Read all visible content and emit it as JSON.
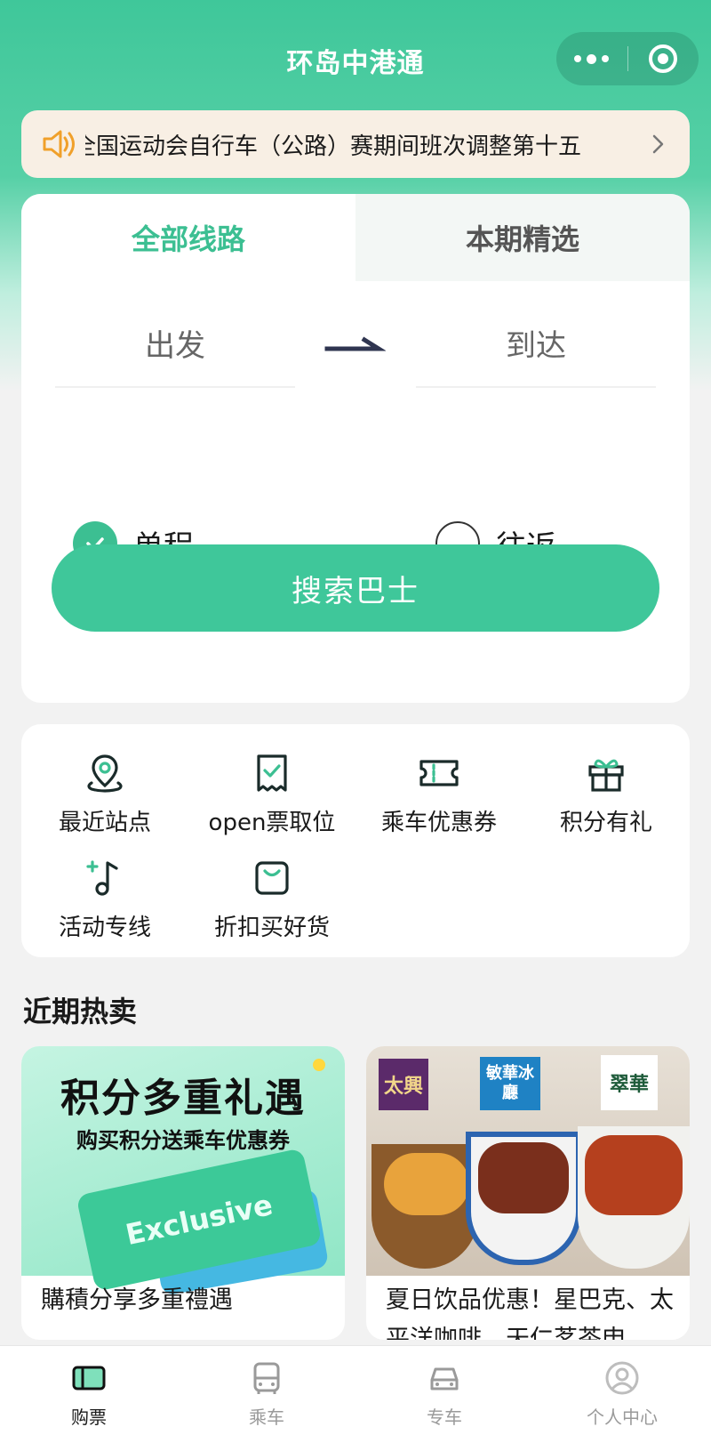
{
  "header": {
    "title": "环岛中港通"
  },
  "notice": {
    "text": "全国运动会自行车（公路）赛期间班次调整第十五"
  },
  "search": {
    "tabs": [
      {
        "label": "全部线路"
      },
      {
        "label": "本期精选"
      }
    ],
    "from_placeholder": "出发",
    "to_placeholder": "到达",
    "trip_single": "单程",
    "trip_round": "往返",
    "button_label": "搜索巴士"
  },
  "quick_links": [
    {
      "label": "最近站点",
      "icon": "location-pin-icon"
    },
    {
      "label": "open票取位",
      "icon": "ticket-check-icon"
    },
    {
      "label": "乘车优惠券",
      "icon": "coupon-icon"
    },
    {
      "label": "积分有礼",
      "icon": "gift-icon"
    },
    {
      "label": "活动专线",
      "icon": "music-note-icon"
    },
    {
      "label": "折扣买好货",
      "icon": "shopping-bag-icon"
    }
  ],
  "hot": {
    "title": "近期热卖",
    "promos": [
      {
        "image_title": "积分多重礼遇",
        "image_subtitle": "购买积分送乘车优惠券",
        "image_ticket_text": "Exclusive",
        "caption": "購積分享多重禮遇"
      },
      {
        "brand_1": "太興",
        "brand_2": "敏華冰廳",
        "brand_3": "翠華",
        "caption": "夏日饮品优惠！星巴克、太平洋咖啡、天仁茗茶申"
      }
    ]
  },
  "tabbar": [
    {
      "label": "购票",
      "icon": "ticket-icon",
      "active": true
    },
    {
      "label": "乘车",
      "icon": "bus-icon",
      "active": false
    },
    {
      "label": "专车",
      "icon": "car-icon",
      "active": false
    },
    {
      "label": "个人中心",
      "icon": "user-icon",
      "active": false
    }
  ],
  "colors": {
    "accent": "#3fc79a",
    "notice_bg": "#f8efe4",
    "page_bg": "#f2f2f2"
  }
}
